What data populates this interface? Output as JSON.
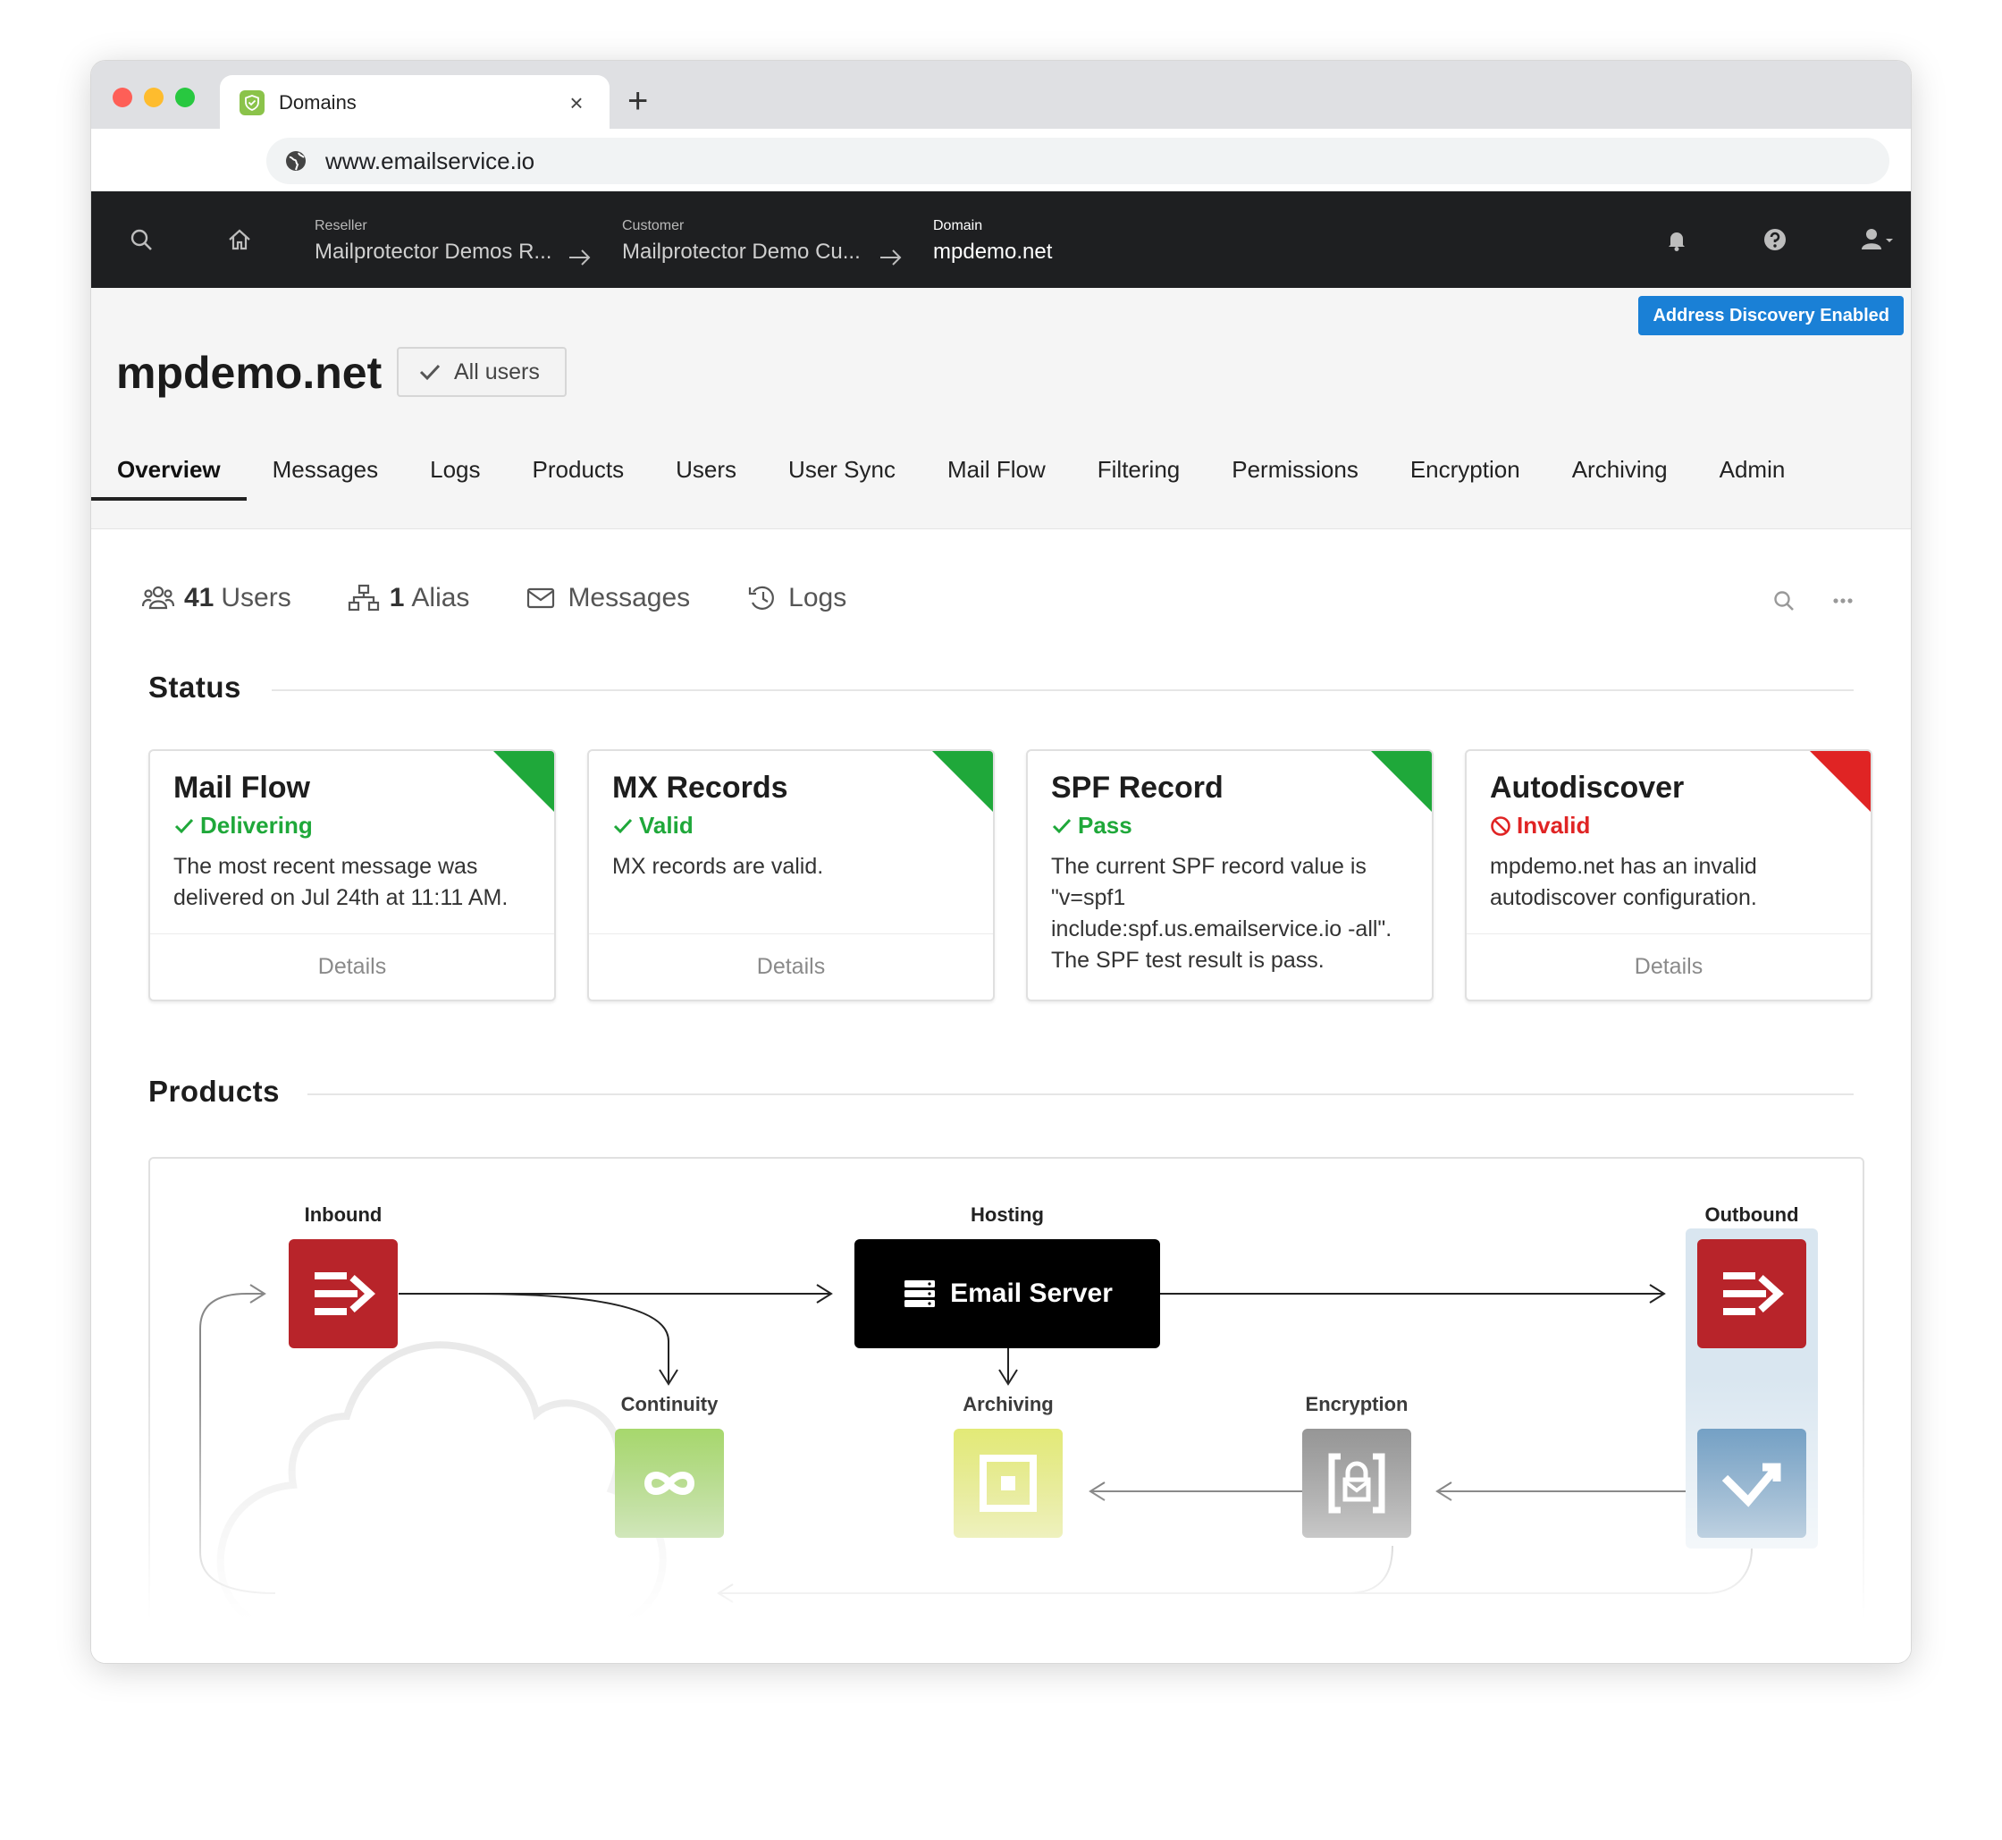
{
  "browser": {
    "tab_title": "Domains",
    "tab_close": "×",
    "new_tab": "+",
    "url": "www.emailservice.io"
  },
  "appbar": {
    "breadcrumbs": [
      {
        "label": "Reseller",
        "value": "Mailprotector Demos R..."
      },
      {
        "label": "Customer",
        "value": "Mailprotector Demo Cu..."
      },
      {
        "label": "Domain",
        "value": "mpdemo.net"
      }
    ]
  },
  "domain": {
    "badge": "Address Discovery Enabled",
    "title": "mpdemo.net",
    "all_users": "All users",
    "tabs": [
      "Overview",
      "Messages",
      "Logs",
      "Products",
      "Users",
      "User Sync",
      "Mail Flow",
      "Filtering",
      "Permissions",
      "Encryption",
      "Archiving",
      "Admin"
    ],
    "active_tab": "Overview"
  },
  "quicklinks": {
    "users_count": "41",
    "users_label": "Users",
    "alias_count": "1",
    "alias_label": "Alias",
    "messages_label": "Messages",
    "logs_label": "Logs"
  },
  "status": {
    "title": "Status",
    "cards": [
      {
        "title": "Mail Flow",
        "status": "Delivering",
        "state": "ok",
        "description": "The most recent message was delivered on Jul 24th at 11:11 AM.",
        "footer": "Details"
      },
      {
        "title": "MX Records",
        "status": "Valid",
        "state": "ok",
        "description": "MX records are valid.",
        "footer": "Details"
      },
      {
        "title": "SPF Record",
        "status": "Pass",
        "state": "ok",
        "description": "The current SPF record value is \"v=spf1 include:spf.us.emailservice.io -all\". The SPF test result is pass.",
        "footer": ""
      },
      {
        "title": "Autodiscover",
        "status": "Invalid",
        "state": "error",
        "description": "mpdemo.net has an invalid autodiscover configuration.",
        "footer": "Details"
      }
    ]
  },
  "products": {
    "title": "Products",
    "inbound_label": "Inbound",
    "hosting_label": "Hosting",
    "email_server": "Email Server",
    "outbound_label": "Outbound",
    "continuity_label": "Continuity",
    "archiving_label": "Archiving",
    "encryption_label": "Encryption"
  },
  "colors": {
    "ok": "#1fa83a",
    "error": "#e02424",
    "inbound": "#b8242a",
    "continuity": "#86c540",
    "archiving": "#d6de4a",
    "encryption": "#6b6b6b",
    "outbound_arrow": "#4f87b5",
    "badge": "#1a80d6"
  },
  "icons": [
    "shield-favicon",
    "back-arrow-icon",
    "forward-arrow-icon",
    "reload-icon",
    "globe-icon",
    "search-icon",
    "home-icon",
    "bell-icon",
    "help-icon",
    "user-icon",
    "check-icon",
    "users-icon",
    "sitemap-icon",
    "envelope-icon",
    "history-icon",
    "ellipsis-icon",
    "ban-icon",
    "server-icon",
    "inbound-arrow-icon",
    "infinity-icon",
    "archive-icon",
    "lock-envelope-icon",
    "outbound-check-icon",
    "cloud-icon"
  ]
}
